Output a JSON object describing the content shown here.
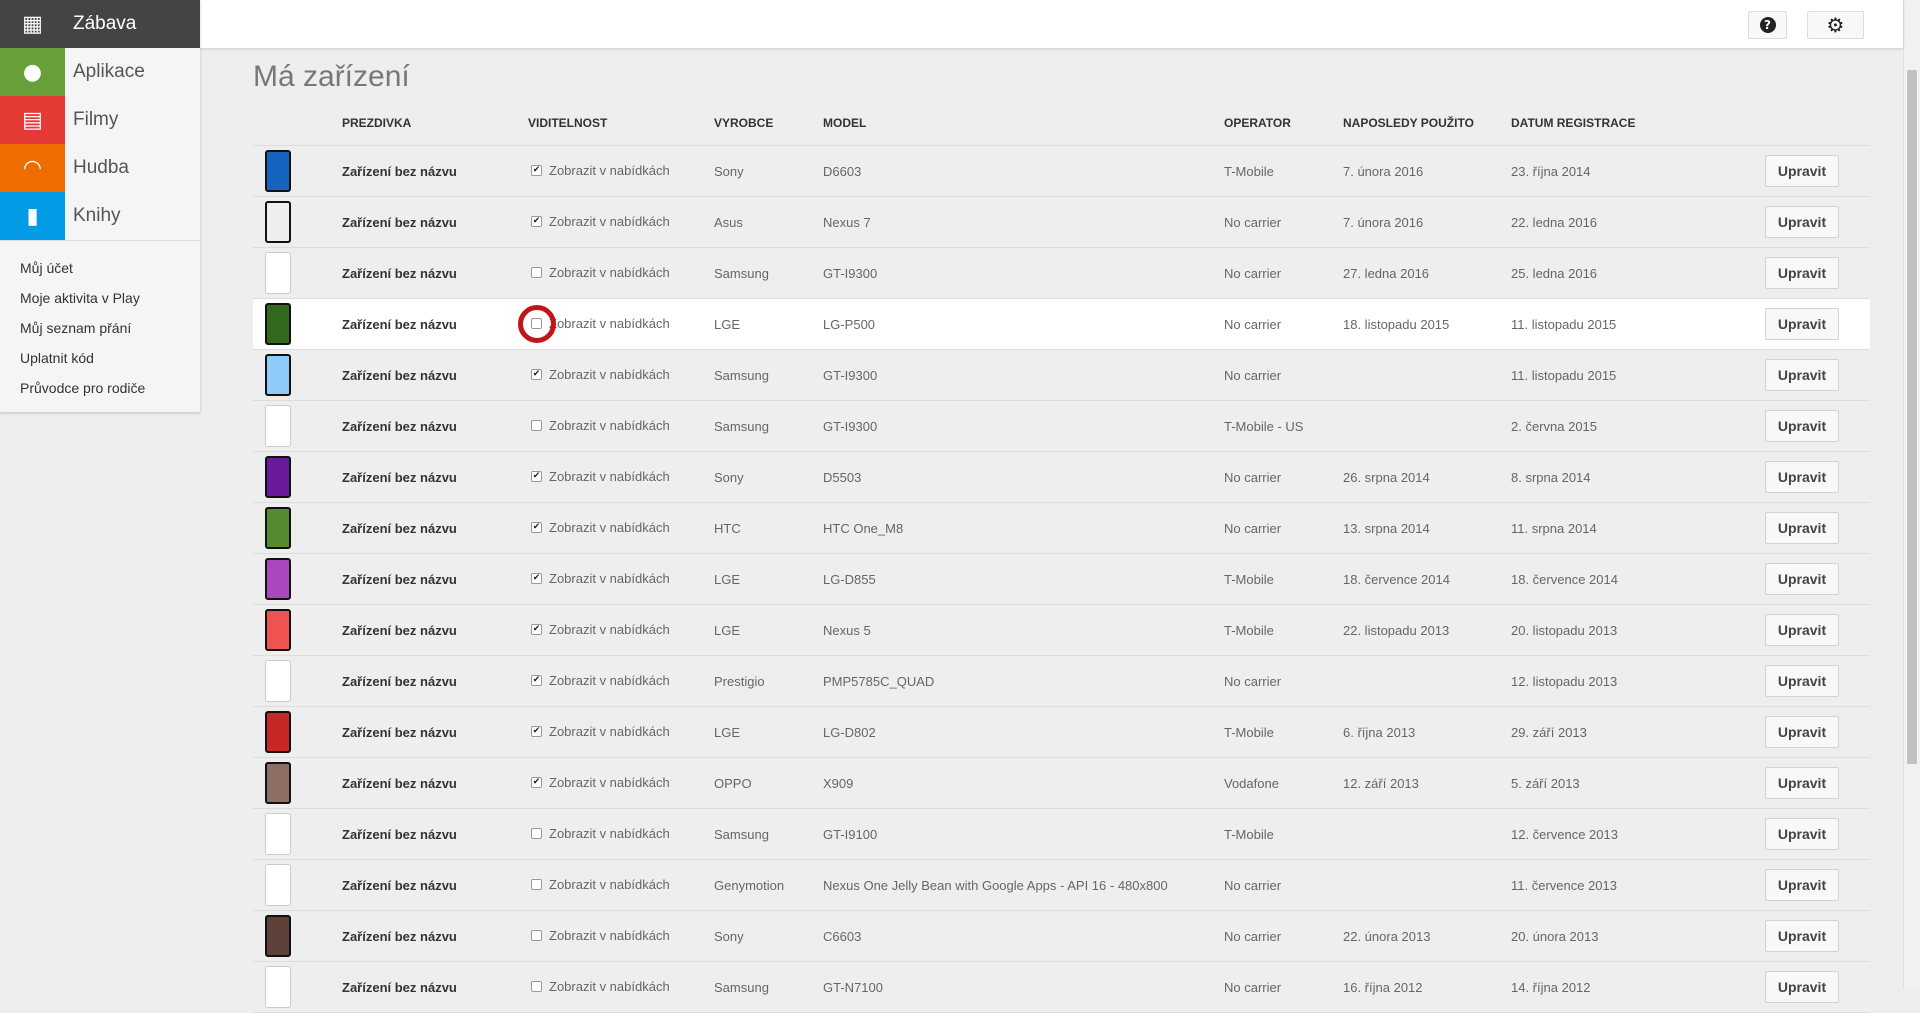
{
  "sidebar": {
    "categories": [
      {
        "label": "Zábava",
        "icon": "grid-icon",
        "color": "#444444"
      },
      {
        "label": "Aplikace",
        "icon": "android-icon",
        "color": "#689f38"
      },
      {
        "label": "Filmy",
        "icon": "film-icon",
        "color": "#e53935"
      },
      {
        "label": "Hudba",
        "icon": "headphones-icon",
        "color": "#ef6c00"
      },
      {
        "label": "Knihy",
        "icon": "book-icon",
        "color": "#039be5"
      }
    ],
    "links": [
      "Můj účet",
      "Moje aktivita v Play",
      "Můj seznam přání",
      "Uplatnit kód",
      "Průvodce pro rodiče"
    ]
  },
  "header": {
    "help_icon": "help-icon",
    "settings_icon": "gear-icon"
  },
  "page_title": "Má zařízení",
  "columns": [
    "PREZDIVKA",
    "VIDITELNOST",
    "VYROBCE",
    "MODEL",
    "OPERATOR",
    "NAPOSLEDY POUŽITO",
    "DATUM REGISTRACE"
  ],
  "visibility_label": "Zobrazit v nabídkách",
  "edit_label": "Upravit",
  "devices": [
    {
      "nick": "Zařízení bez názvu",
      "visible": true,
      "maker": "Sony",
      "model": "D6603",
      "operator": "T-Mobile",
      "last_used": "7. února 2016",
      "registered": "23. října 2014",
      "phone": "#1565c0"
    },
    {
      "nick": "Zařízení bez názvu",
      "visible": true,
      "maker": "Asus",
      "model": "Nexus 7",
      "operator": "No carrier",
      "last_used": "7. února 2016",
      "registered": "22. ledna 2016",
      "phone": "#eeeeee"
    },
    {
      "nick": "Zařízení bez názvu",
      "visible": false,
      "maker": "Samsung",
      "model": "GT-I9300",
      "operator": "No carrier",
      "last_used": "27. ledna 2016",
      "registered": "25. ledna 2016",
      "phone": ""
    },
    {
      "nick": "Zařízení bez názvu",
      "visible": false,
      "maker": "LGE",
      "model": "LG-P500",
      "operator": "No carrier",
      "last_used": "18. listopadu 2015",
      "registered": "11. listopadu 2015",
      "phone": "#33691e",
      "highlight": true
    },
    {
      "nick": "Zařízení bez názvu",
      "visible": true,
      "maker": "Samsung",
      "model": "GT-I9300",
      "operator": "No carrier",
      "last_used": "",
      "registered": "11. listopadu 2015",
      "phone": "#90caf9"
    },
    {
      "nick": "Zařízení bez názvu",
      "visible": false,
      "maker": "Samsung",
      "model": "GT-I9300",
      "operator": "T-Mobile - US",
      "last_used": "",
      "registered": "2. června 2015",
      "phone": ""
    },
    {
      "nick": "Zařízení bez názvu",
      "visible": true,
      "maker": "Sony",
      "model": "D5503",
      "operator": "No carrier",
      "last_used": "26. srpna 2014",
      "registered": "8. srpna 2014",
      "phone": "#6a1b9a"
    },
    {
      "nick": "Zařízení bez názvu",
      "visible": true,
      "maker": "HTC",
      "model": "HTC One_M8",
      "operator": "No carrier",
      "last_used": "13. srpna 2014",
      "registered": "11. srpna 2014",
      "phone": "#558b2f"
    },
    {
      "nick": "Zařízení bez názvu",
      "visible": true,
      "maker": "LGE",
      "model": "LG-D855",
      "operator": "T-Mobile",
      "last_used": "18. července 2014",
      "registered": "18. července 2014",
      "phone": "#ab47bc"
    },
    {
      "nick": "Zařízení bez názvu",
      "visible": true,
      "maker": "LGE",
      "model": "Nexus 5",
      "operator": "T-Mobile",
      "last_used": "22. listopadu 2013",
      "registered": "20. listopadu 2013",
      "phone": "#ef5350"
    },
    {
      "nick": "Zařízení bez názvu",
      "visible": true,
      "maker": "Prestigio",
      "model": "PMP5785C_QUAD",
      "operator": "No carrier",
      "last_used": "",
      "registered": "12. listopadu 2013",
      "phone": ""
    },
    {
      "nick": "Zařízení bez názvu",
      "visible": true,
      "maker": "LGE",
      "model": "LG-D802",
      "operator": "T-Mobile",
      "last_used": "6. října 2013",
      "registered": "29. září 2013",
      "phone": "#c62828"
    },
    {
      "nick": "Zařízení bez názvu",
      "visible": true,
      "maker": "OPPO",
      "model": "X909",
      "operator": "Vodafone",
      "last_used": "12. září 2013",
      "registered": "5. září 2013",
      "phone": "#8d6e63"
    },
    {
      "nick": "Zařízení bez názvu",
      "visible": false,
      "maker": "Samsung",
      "model": "GT-I9100",
      "operator": "T-Mobile",
      "last_used": "",
      "registered": "12. července 2013",
      "phone": ""
    },
    {
      "nick": "Zařízení bez názvu",
      "visible": false,
      "maker": "Genymotion",
      "model": "Nexus One Jelly Bean with Google Apps - API 16 - 480x800",
      "operator": "No carrier",
      "last_used": "",
      "registered": "11. července 2013",
      "phone": ""
    },
    {
      "nick": "Zařízení bez názvu",
      "visible": false,
      "maker": "Sony",
      "model": "C6603",
      "operator": "No carrier",
      "last_used": "22. února 2013",
      "registered": "20. února 2013",
      "phone": "#5d4037"
    },
    {
      "nick": "Zařízení bez názvu",
      "visible": false,
      "maker": "Samsung",
      "model": "GT-N7100",
      "operator": "No carrier",
      "last_used": "16. října 2012",
      "registered": "14. října 2012",
      "phone": ""
    }
  ]
}
